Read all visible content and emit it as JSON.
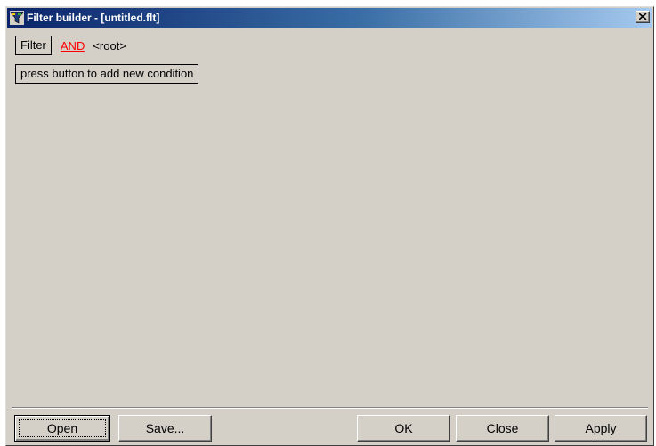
{
  "window": {
    "title": "Filter builder - [untitled.flt]",
    "colors": {
      "titlebar_start": "#0a246a",
      "titlebar_end": "#a6caf0",
      "face": "#d4d0c8",
      "and_link": "#ff0000"
    }
  },
  "filter_row": {
    "filter_button": "Filter",
    "operator_link": "AND",
    "node_label": "<root>"
  },
  "add_condition_button": "press button to add new condition",
  "buttons": {
    "open": "Open",
    "save": "Save...",
    "ok": "OK",
    "close": "Close",
    "apply": "Apply"
  },
  "icons": {
    "app": "filter-funnel-icon",
    "close": "close-x-icon"
  }
}
